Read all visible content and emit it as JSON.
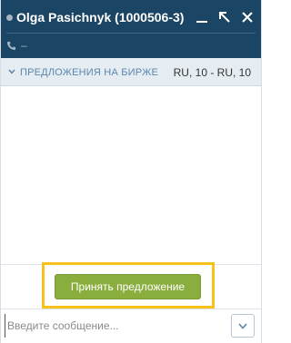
{
  "header": {
    "contact_name": "Olga Pasichnyk (1000506-3)",
    "phone": "–",
    "status_color": "#a8b4bf",
    "background_color": "#1b4564"
  },
  "offers": {
    "label": "ПРЕДЛОЖЕНИЯ НА БИРЖЕ",
    "value": "RU, 10 - RU, 10"
  },
  "actions": {
    "accept_label": "Принять предложение",
    "accept_color": "#8aae3e",
    "highlight_color": "#f6c21a"
  },
  "composer": {
    "placeholder": "Введите сообщение..."
  },
  "icons": {
    "minimize": "minimize-icon",
    "popout": "popout-icon",
    "close": "close-icon",
    "phone": "phone-icon",
    "offers_toggle": "chevron-down-icon",
    "expand": "chevron-down-icon"
  }
}
